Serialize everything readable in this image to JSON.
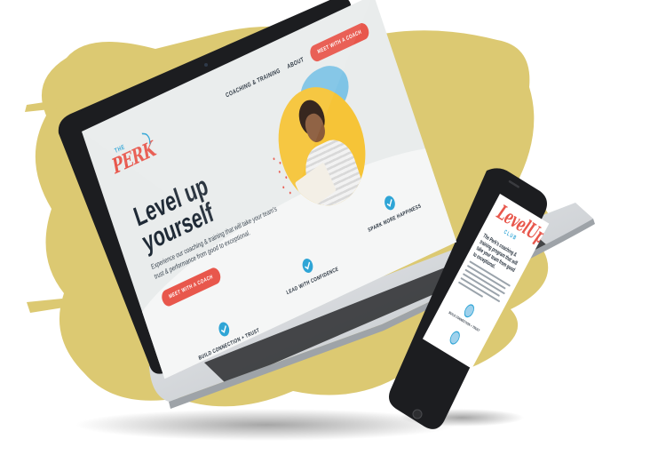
{
  "colors": {
    "brush": "#dcc972",
    "accent_red": "#e8574c",
    "accent_blue": "#2fa5d6",
    "accent_yellow": "#f6c437",
    "ink": "#1f2a36",
    "device_dark": "#1c1d20",
    "device_silver": "#cfd2d6"
  },
  "laptop": {
    "logo_small": "THE",
    "logo_main": "PERK",
    "nav": {
      "link1": "COACHING & TRAINING",
      "link2": "ABOUT",
      "cta": "MEET WITH A COACH"
    },
    "hero": {
      "title_line1": "Level up",
      "title_line2": "yourself",
      "subtitle": "Experience our coaching & training that will take your team's trust & performance from good to exceptional.",
      "button": "MEET WITH A COACH"
    },
    "features": [
      {
        "label": "BUILD CONNECTION + TRUST",
        "icon": "check-circle-icon"
      },
      {
        "label": "LEAD WITH CONFIDENCE",
        "icon": "check-circle-icon"
      },
      {
        "label": "SPARK MORE HAPPINESS",
        "icon": "check-circle-icon"
      }
    ]
  },
  "phone": {
    "logo_main": "LevelUp",
    "logo_sub": "CLUB",
    "heading": "The Perk's coaching & training program that will take your team from good to exceptional."
  }
}
